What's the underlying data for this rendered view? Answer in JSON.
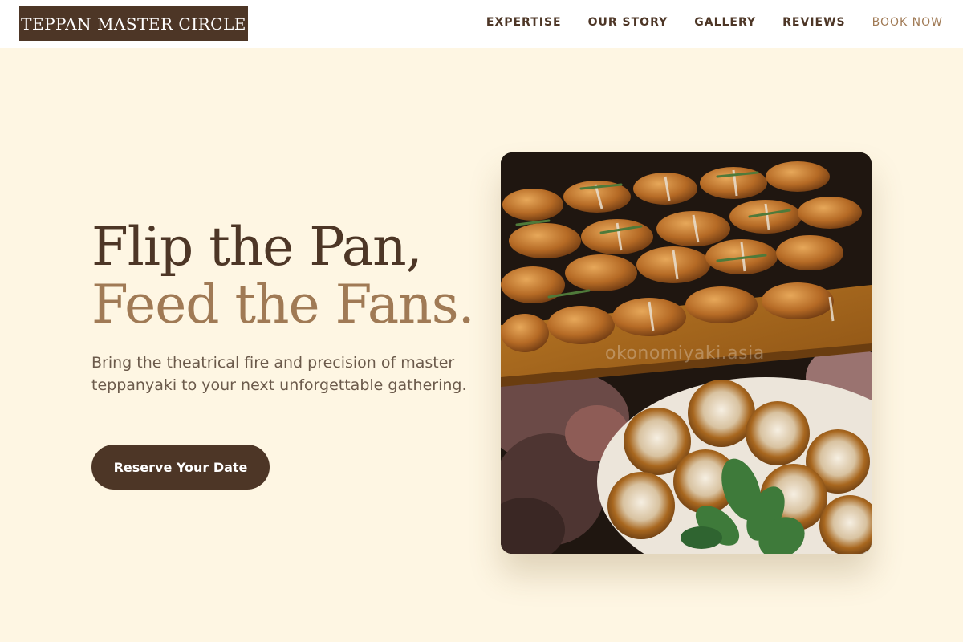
{
  "header": {
    "logo": "TEPPAN MASTER CIRCLE",
    "nav": [
      {
        "label": "EXPERTISE"
      },
      {
        "label": "OUR STORY"
      },
      {
        "label": "GALLERY"
      },
      {
        "label": "REVIEWS"
      },
      {
        "label": "BOOK NOW"
      }
    ]
  },
  "hero": {
    "headline_line1": "Flip the Pan,",
    "headline_line2": "Feed the Fans.",
    "subtitle": "Bring the theatrical fire and precision of master teppanyaki to your next unforgettable gathering.",
    "cta_label": "Reserve Your Date",
    "image": {
      "subject": "croissants-and-tartlets-photo",
      "watermark": "okonomiyaki.asia"
    }
  },
  "colors": {
    "background": "#fef6e3",
    "brand_dark": "#4d3626",
    "accent": "#a07a55",
    "body_text": "#6b5a4b"
  }
}
